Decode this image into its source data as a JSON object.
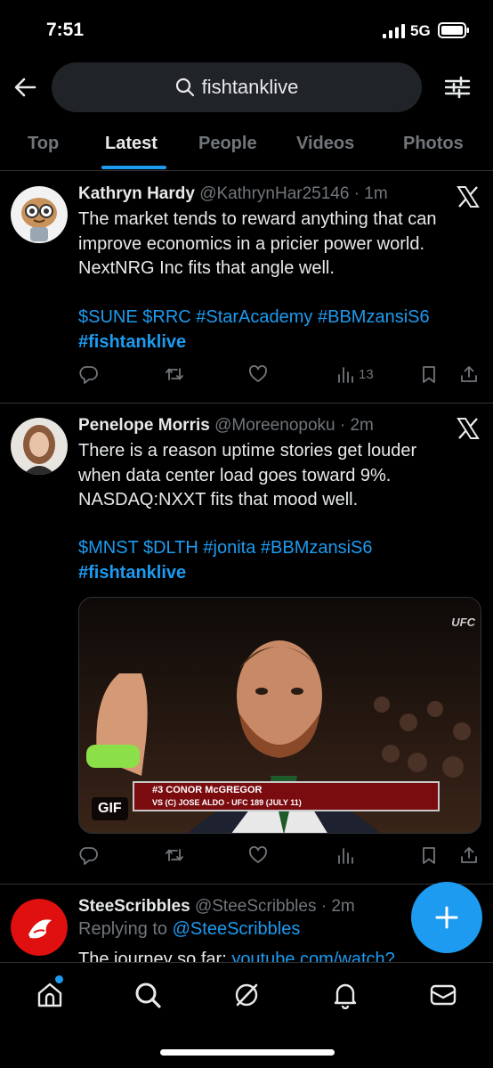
{
  "status_bar": {
    "time": "7:51",
    "network": "5G"
  },
  "search": {
    "value": "fishtanklive"
  },
  "tabs": [
    {
      "label": "Top"
    },
    {
      "label": "Latest"
    },
    {
      "label": "People"
    },
    {
      "label": "Videos"
    },
    {
      "label": "Photos"
    }
  ],
  "active_tab": "Latest",
  "tweets": [
    {
      "name": "Kathryn Hardy",
      "meta": "@KathrynHar25146 · 1m",
      "body_lines": [
        "The market tends to reward anything that can",
        "improve economics in a pricier power world.",
        "NextNRG Inc fits that angle well."
      ],
      "tags_line": "$SUNE $RRC #StarAcademy #BBMzansiS6",
      "hashtag": "#fishtanklive",
      "views": "13"
    },
    {
      "name": "Penelope Morris",
      "meta": "@Moreenopoku · 2m",
      "body_lines": [
        "There is a reason uptime stories get louder",
        "when data center load goes toward 9%.",
        "NASDAQ:NXXT fits that mood well."
      ],
      "tags_line": "$MNST $DLTH #jonita #BBMzansiS6",
      "hashtag": "#fishtanklive",
      "media": {
        "badge": "GIF",
        "caption_line1": "#3 CONOR McGREGOR",
        "caption_line2": "VS (C) JOSE ALDO - UFC 189 (JULY 11)",
        "corner_logo": "UFC"
      }
    },
    {
      "name": "SteeScribbles",
      "meta": "@SteeScribbles · 2m",
      "replying_prefix": "Replying to ",
      "replying_to": "@SteeScribbles",
      "cut_text": "The journey so far: ",
      "cut_link": "youtube.com/watch?"
    }
  ],
  "colors": {
    "accent": "#1d9bf0",
    "background": "#000000",
    "muted": "#71767b",
    "divider": "#2f3336"
  },
  "icons": [
    "back-arrow-icon",
    "search-icon",
    "filter-sliders-icon",
    "x-logo-icon",
    "reply-icon",
    "retweet-icon",
    "like-icon",
    "views-icon",
    "bookmark-icon",
    "share-icon",
    "compose-plus-icon",
    "home-icon",
    "explore-icon",
    "grok-icon",
    "notifications-icon",
    "messages-icon"
  ]
}
